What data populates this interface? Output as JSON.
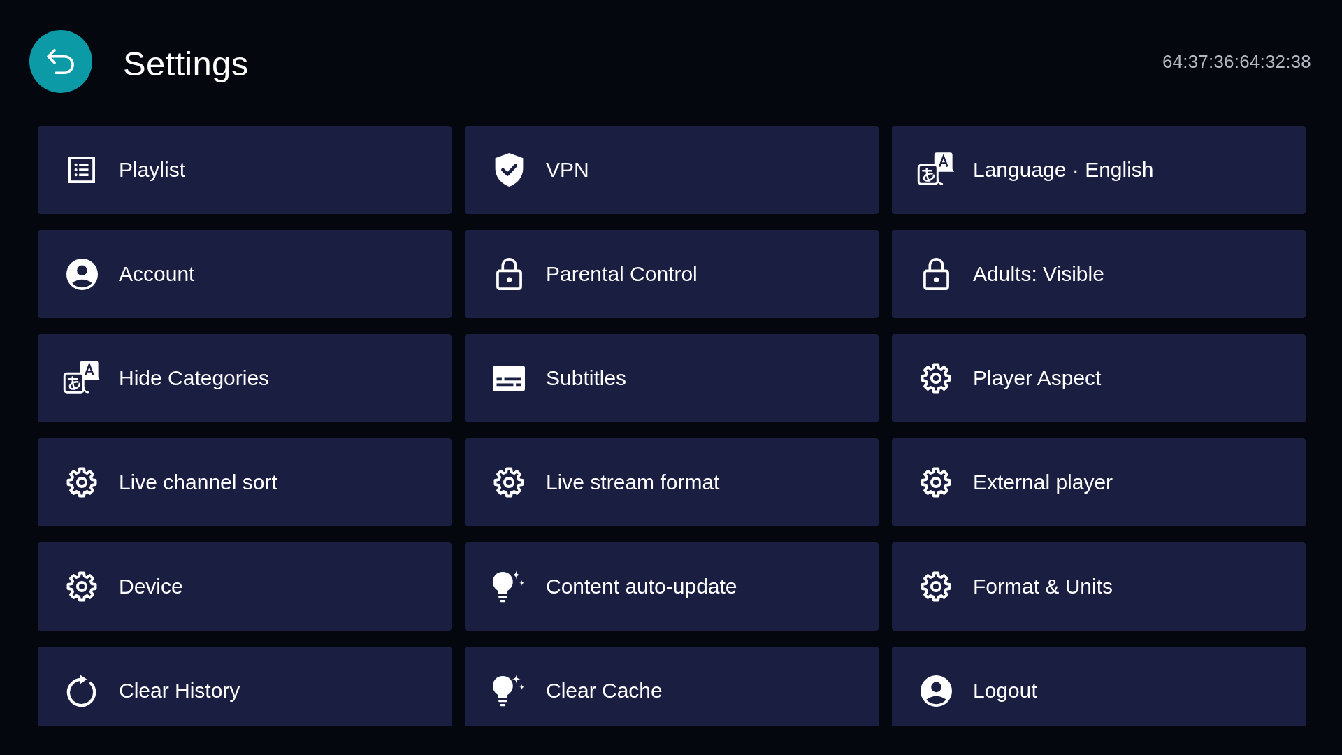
{
  "header": {
    "title": "Settings",
    "clock": "64:37:36:64:32:38"
  },
  "items": [
    {
      "label": "Playlist"
    },
    {
      "label": "VPN"
    },
    {
      "label": "Language · English"
    },
    {
      "label": "Account"
    },
    {
      "label": "Parental Control"
    },
    {
      "label": "Adults: Visible"
    },
    {
      "label": "Hide Categories"
    },
    {
      "label": "Subtitles"
    },
    {
      "label": "Player Aspect"
    },
    {
      "label": "Live channel sort"
    },
    {
      "label": "Live stream format"
    },
    {
      "label": "External player"
    },
    {
      "label": "Device"
    },
    {
      "label": "Content auto-update"
    },
    {
      "label": "Format & Units"
    },
    {
      "label": "Clear History"
    },
    {
      "label": "Clear Cache"
    },
    {
      "label": "Logout"
    }
  ]
}
